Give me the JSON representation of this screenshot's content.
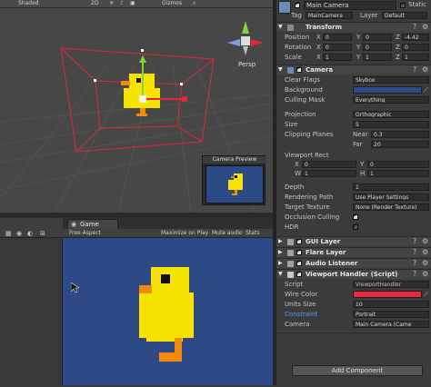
{
  "scene": {
    "toolbar": {
      "shading": "Shaded",
      "mode_2d": "2D",
      "gizmos": "Gizmos"
    },
    "persp_label": "Persp",
    "camera_preview": {
      "title": "Camera Preview"
    }
  },
  "game": {
    "tab_label": "Game",
    "aspect": "Free Aspect",
    "maximize": "Maximize on Play",
    "mute": "Mute audio",
    "stats": "Stats"
  },
  "inspector": {
    "object_name": "Main Camera",
    "static_label": "Static",
    "tag_label": "Tag",
    "tag_value": "MainCamera",
    "layer_label": "Layer",
    "layer_value": "Default",
    "transform": {
      "title": "Transform",
      "position_label": "Position",
      "position": {
        "x": "0",
        "y": "0",
        "z": "-4.42"
      },
      "rotation_label": "Rotation",
      "rotation": {
        "x": "0",
        "y": "0",
        "z": "0"
      },
      "scale_label": "Scale",
      "scale": {
        "x": "1",
        "y": "1",
        "z": "1"
      }
    },
    "camera": {
      "title": "Camera",
      "clear_flags_label": "Clear Flags",
      "clear_flags": "Skybox",
      "background_label": "Background",
      "culling_mask_label": "Culling Mask",
      "culling_mask": "Everything",
      "projection_label": "Projection",
      "projection": "Orthographic",
      "size_label": "Size",
      "size": "5",
      "clipping_label": "Clipping Planes",
      "near_label": "Near",
      "near": "0.3",
      "far_label": "Far",
      "far": "20",
      "viewport_label": "Viewport Rect",
      "vx_label": "X",
      "vx": "0",
      "vy_label": "Y",
      "vy": "0",
      "vw_label": "W",
      "vw": "1",
      "vh_label": "H",
      "vh": "1",
      "depth_label": "Depth",
      "depth": "1",
      "rendering_path_label": "Rendering Path",
      "rendering_path": "Use Player Settings",
      "target_texture_label": "Target Texture",
      "target_texture": "None (Render Texture)",
      "occlusion_label": "Occlusion Culling",
      "hdr_label": "HDR"
    },
    "gui_layer": "GUI Layer",
    "flare_layer": "Flare Layer",
    "audio_listener": "Audio Listener",
    "viewport_handler": {
      "title": "Viewport Handler (Script)",
      "script_label": "Script",
      "script": "ViewportHandler",
      "wire_color_label": "Wire Color",
      "units_size_label": "Units Size",
      "units_size": "10",
      "constraint_label": "Constraint",
      "constraint": "Portrait",
      "camera_label": "Camera",
      "camera": "Main Camera (Came"
    },
    "add_component": "Add Component"
  },
  "colors": {
    "background_swatch": "#2c4a86",
    "wire_color": "#e8283c",
    "game_bg": "#2d4a87",
    "chick_yellow": "#f6e400",
    "chick_orange": "#f28a0a"
  }
}
